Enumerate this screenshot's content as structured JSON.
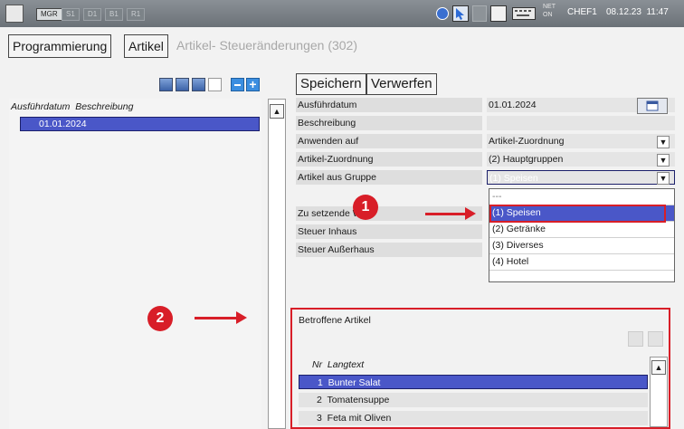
{
  "topbar": {
    "chips": [
      "MGR",
      "S1",
      "D1",
      "B1",
      "R1"
    ],
    "net_top": "NET",
    "net_bottom": "ON",
    "user": "CHEF1",
    "datetime": "08.12.23  11:47"
  },
  "breadcrumb": {
    "items": [
      "Programmierung",
      "Artikel"
    ],
    "current": "Artikel- Steueränderungen (302)"
  },
  "toolbar": {
    "save_label": "Speichern",
    "discard_label": "Verwerfen"
  },
  "left_list": {
    "header": "Ausführdatum  Beschreibung",
    "rows": [
      "01.01.2024"
    ]
  },
  "form": {
    "fields": [
      {
        "label": "Ausführdatum",
        "value": "01.01.2024"
      },
      {
        "label": "Beschreibung",
        "value": ""
      },
      {
        "label": "Anwenden auf",
        "value": "Artikel-Zuordnung"
      },
      {
        "label": "Artikel-Zuordnung",
        "value": "(2) Hauptgruppen"
      },
      {
        "label": "Artikel aus Gruppe",
        "value": "(1) Speisen"
      }
    ],
    "extra_labels": [
      "Zu setzende W",
      "Steuer Inhaus",
      "Steuer Außerhaus"
    ]
  },
  "dropdown": {
    "options": [
      "---",
      "(1) Speisen",
      "(2) Getränke",
      "(3) Diverses",
      "(4) Hotel"
    ],
    "selected_index": 1
  },
  "affected": {
    "title": "Betroffene Artikel",
    "header": "Nr  Langtext",
    "rows": [
      "1  Bunter Salat",
      "2  Tomatensuppe",
      "3  Feta mit Oliven"
    ]
  },
  "annotations": {
    "badge1": "1",
    "badge2": "2",
    "accent": "#d81e28",
    "selection": "#4a57c8"
  }
}
